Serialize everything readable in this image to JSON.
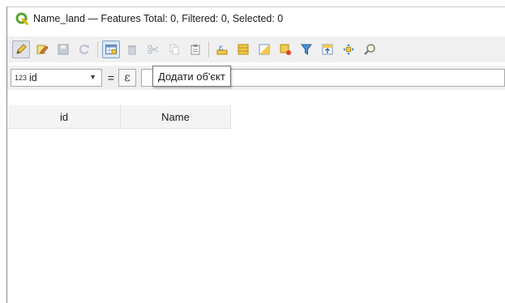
{
  "window": {
    "title": "Name_land — Features Total: 0, Filtered: 0, Selected: 0"
  },
  "toolbar": {
    "buttons": [
      {
        "name": "toggle-editing",
        "icon": "pencil-icon"
      },
      {
        "name": "multi-edit",
        "icon": "multi-edit-icon"
      },
      {
        "name": "save-edits",
        "icon": "save-icon"
      },
      {
        "name": "reload-table",
        "icon": "reload-icon"
      },
      {
        "name": "add-feature",
        "icon": "add-feature-icon"
      },
      {
        "name": "delete-features",
        "icon": "trash-icon"
      },
      {
        "name": "cut-features",
        "icon": "scissors-icon"
      },
      {
        "name": "copy-features",
        "icon": "copy-icon"
      },
      {
        "name": "paste-features",
        "icon": "paste-icon"
      },
      {
        "name": "select-by-expression",
        "icon": "expression-select-icon"
      },
      {
        "name": "select-all",
        "icon": "select-all-icon"
      },
      {
        "name": "invert-selection",
        "icon": "invert-selection-icon"
      },
      {
        "name": "deselect-all",
        "icon": "deselect-icon"
      },
      {
        "name": "filter-select",
        "icon": "filter-icon"
      },
      {
        "name": "move-selection-top",
        "icon": "move-top-icon"
      },
      {
        "name": "pan-to-selected",
        "icon": "pan-icon"
      },
      {
        "name": "zoom-to-selected",
        "icon": "zoom-icon"
      }
    ]
  },
  "filter": {
    "field_type": "123",
    "field": "id",
    "operator": "=",
    "expression_symbol": "ε",
    "value": ""
  },
  "tooltip": {
    "text": "Додати об'єкт"
  },
  "table": {
    "columns": [
      "id",
      "Name"
    ],
    "rows": []
  }
}
